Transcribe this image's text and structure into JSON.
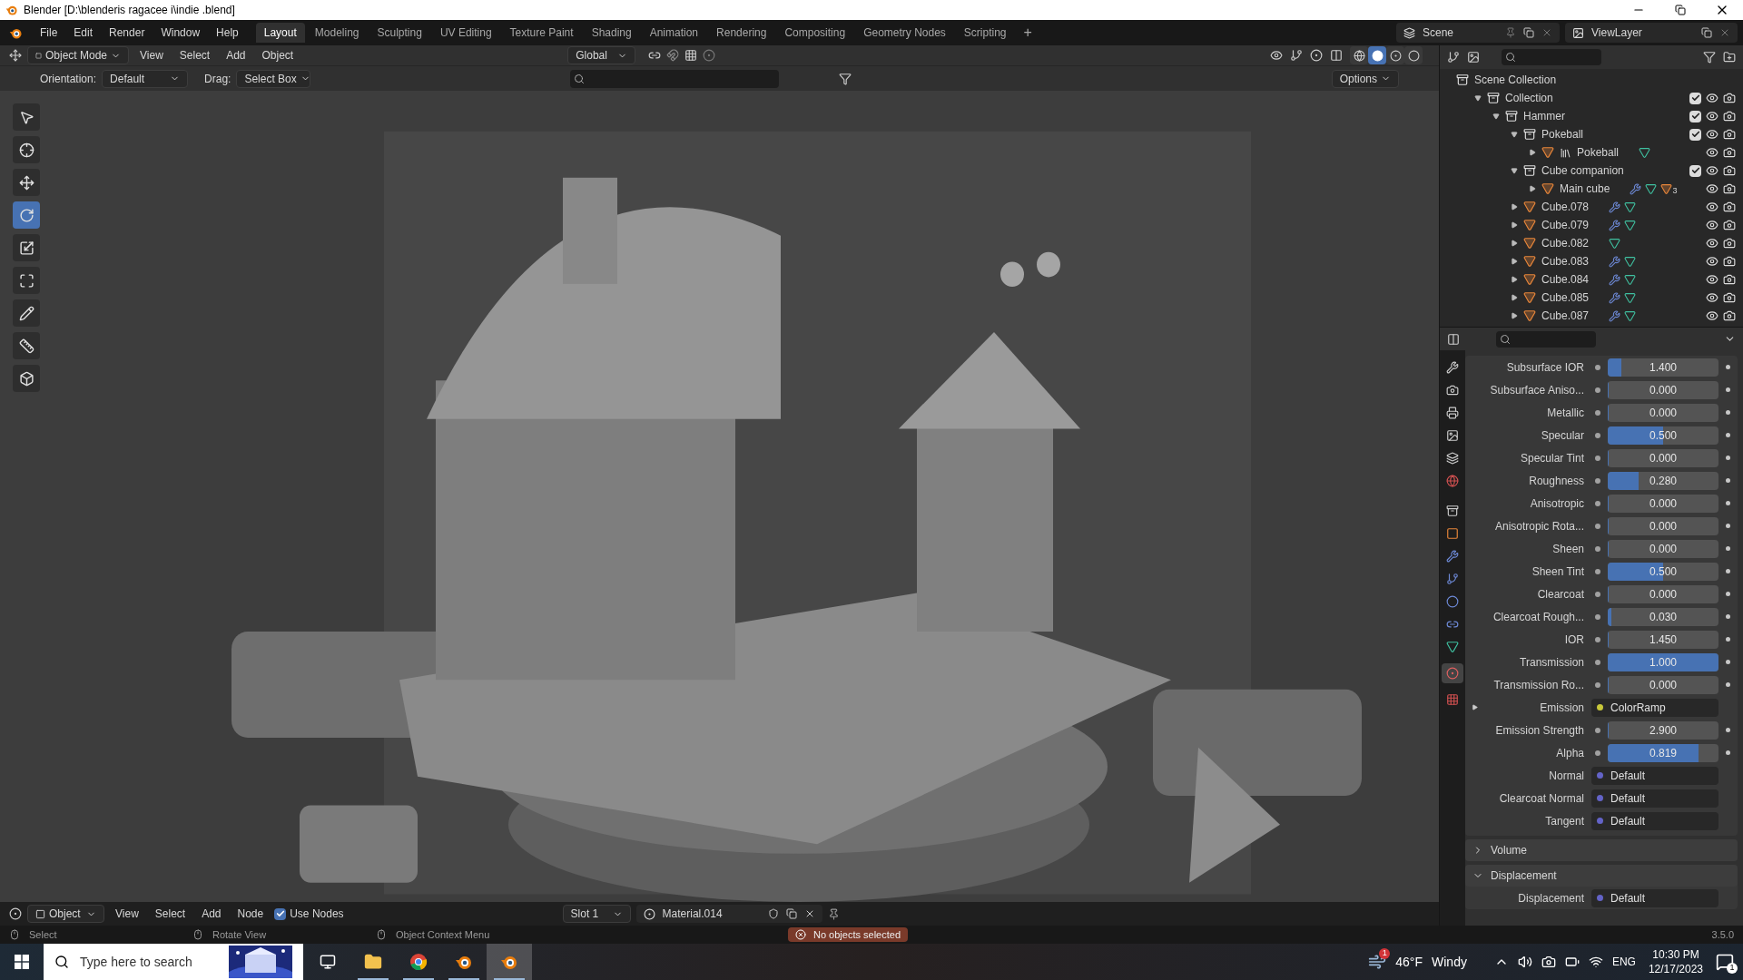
{
  "window": {
    "title": "Blender [D:\\blenderis ragacee i\\indie .blend]"
  },
  "menu": [
    "File",
    "Edit",
    "Render",
    "Window",
    "Help"
  ],
  "workspaces": [
    {
      "label": "Layout",
      "selected": true
    },
    {
      "label": "Modeling",
      "selected": false
    },
    {
      "label": "Sculpting",
      "selected": false
    },
    {
      "label": "UV Editing",
      "selected": false
    },
    {
      "label": "Texture Paint",
      "selected": false
    },
    {
      "label": "Shading",
      "selected": false
    },
    {
      "label": "Animation",
      "selected": false
    },
    {
      "label": "Rendering",
      "selected": false
    },
    {
      "label": "Compositing",
      "selected": false
    },
    {
      "label": "Geometry Nodes",
      "selected": false
    },
    {
      "label": "Scripting",
      "selected": false
    }
  ],
  "add_workspace": "+",
  "scene": "Scene",
  "view_layer": "ViewLayer",
  "viewport": {
    "mode": "Object Mode",
    "menus": [
      "View",
      "Select",
      "Add",
      "Object"
    ],
    "transform": "Global",
    "orientation_label": "Orientation:",
    "orientation": "Default",
    "drag_label": "Drag:",
    "drag": "Select Box",
    "options": "Options",
    "shading": [
      {
        "kind": "wireframe",
        "selected": false
      },
      {
        "kind": "solid",
        "selected": true
      },
      {
        "kind": "material",
        "selected": false
      },
      {
        "kind": "rendered",
        "selected": false
      }
    ],
    "tools": [
      {
        "kind": "select",
        "selected": false
      },
      {
        "kind": "cursor",
        "selected": false
      },
      {
        "kind": "move",
        "selected": false
      },
      {
        "kind": "rotate",
        "selected": true
      },
      {
        "kind": "scale",
        "selected": false
      },
      {
        "kind": "transform",
        "selected": false
      },
      {
        "kind": "annotate",
        "selected": false
      },
      {
        "kind": "measure",
        "selected": false
      },
      {
        "kind": "add-cube",
        "selected": false
      }
    ]
  },
  "outliner": {
    "tree": [
      {
        "label": "Scene Collection",
        "kind": "scene",
        "children": [
          {
            "label": "Collection",
            "kind": "collection",
            "expanded": true,
            "checked": true,
            "children": [
              {
                "label": "Hammer",
                "kind": "collection",
                "expanded": true,
                "checked": true,
                "children": [
                  {
                    "label": "Pokeball",
                    "kind": "collection",
                    "expanded": true,
                    "checked": true,
                    "children": [
                      {
                        "label": "Pokeball",
                        "kind": "object",
                        "expanded": false,
                        "linked": true,
                        "modifier": false,
                        "mesh_data": true
                      }
                    ]
                  },
                  {
                    "label": "Cube companion",
                    "kind": "collection",
                    "expanded": true,
                    "checked": true,
                    "children": [
                      {
                        "label": "Main cube",
                        "kind": "object",
                        "expanded": false,
                        "linked": false,
                        "modifier": true,
                        "mesh_data": true,
                        "child_count": "3"
                      }
                    ]
                  },
                  {
                    "label": "Cube.078",
                    "kind": "object",
                    "expanded": false,
                    "linked": false,
                    "modifier": true,
                    "mesh_data": true
                  },
                  {
                    "label": "Cube.079",
                    "kind": "object",
                    "expanded": false,
                    "linked": false,
                    "modifier": true,
                    "mesh_data": true
                  },
                  {
                    "label": "Cube.082",
                    "kind": "object",
                    "expanded": false,
                    "linked": false,
                    "modifier": false,
                    "mesh_data": true
                  },
                  {
                    "label": "Cube.083",
                    "kind": "object",
                    "expanded": false,
                    "linked": false,
                    "modifier": true,
                    "mesh_data": true
                  },
                  {
                    "label": "Cube.084",
                    "kind": "object",
                    "expanded": false,
                    "linked": false,
                    "modifier": true,
                    "mesh_data": true
                  },
                  {
                    "label": "Cube.085",
                    "kind": "object",
                    "expanded": false,
                    "linked": false,
                    "modifier": true,
                    "mesh_data": true
                  },
                  {
                    "label": "Cube.087",
                    "kind": "object",
                    "expanded": false,
                    "linked": false,
                    "modifier": true,
                    "mesh_data": true
                  }
                ]
              }
            ]
          }
        ]
      }
    ]
  },
  "properties": {
    "rows": [
      {
        "label": "Subsurface IOR",
        "kind": "slider",
        "value": "1.400",
        "level": 0.12
      },
      {
        "label": "Subsurface Aniso...",
        "kind": "slider",
        "value": "0.000",
        "level": 0
      },
      {
        "label": "Metallic",
        "kind": "slider",
        "value": "0.000",
        "level": 0
      },
      {
        "label": "Specular",
        "kind": "slider",
        "value": "0.500",
        "level": 0.5
      },
      {
        "label": "Specular Tint",
        "kind": "slider",
        "value": "0.000",
        "level": 0
      },
      {
        "label": "Roughness",
        "kind": "slider",
        "value": "0.280",
        "level": 0.28
      },
      {
        "label": "Anisotropic",
        "kind": "slider",
        "value": "0.000",
        "level": 0
      },
      {
        "label": "Anisotropic Rota...",
        "kind": "slider",
        "value": "0.000",
        "level": 0
      },
      {
        "label": "Sheen",
        "kind": "slider",
        "value": "0.000",
        "level": 0
      },
      {
        "label": "Sheen Tint",
        "kind": "slider",
        "value": "0.500",
        "level": 0.5
      },
      {
        "label": "Clearcoat",
        "kind": "slider",
        "value": "0.000",
        "level": 0
      },
      {
        "label": "Clearcoat Rough...",
        "kind": "slider",
        "value": "0.030",
        "level": 0.03
      },
      {
        "label": "IOR",
        "kind": "slider",
        "value": "1.450",
        "level": 0
      },
      {
        "label": "Transmission",
        "kind": "slider",
        "value": "1.000",
        "level": 1
      },
      {
        "label": "Transmission Ro...",
        "kind": "slider",
        "value": "0.000",
        "level": 0
      },
      {
        "label": "Emission",
        "kind": "input",
        "value": "ColorRamp",
        "color": "#c8c83a"
      },
      {
        "label": "Emission Strength",
        "kind": "slider",
        "value": "2.900",
        "level": 0
      },
      {
        "label": "Alpha",
        "kind": "slider",
        "value": "0.819",
        "level": 0.819
      },
      {
        "label": "Normal",
        "kind": "link",
        "value": "Default",
        "color": "#6363c7"
      },
      {
        "label": "Clearcoat Normal",
        "kind": "link",
        "value": "Default",
        "color": "#6363c7"
      },
      {
        "label": "Tangent",
        "kind": "link",
        "value": "Default",
        "color": "#6363c7"
      }
    ],
    "panels": [
      {
        "label": "Volume",
        "expanded": false
      },
      {
        "label": "Displacement",
        "expanded": true,
        "rows": [
          {
            "label": "Displacement",
            "kind": "link",
            "value": "Default",
            "color": "#6363c7"
          }
        ]
      }
    ]
  },
  "shader_header": {
    "editor": "Object",
    "menus": [
      "View",
      "Select",
      "Add",
      "Node"
    ],
    "use_nodes": {
      "label": "Use Nodes",
      "checked": true
    },
    "slot": "Slot 1",
    "material": "Material.014"
  },
  "status_bar": {
    "hints": [
      "Select",
      "Rotate View",
      "Object Context Menu"
    ],
    "message": "No objects selected",
    "version": "3.5.0"
  },
  "taskbar": {
    "search_placeholder": "Type here to search",
    "apps": [
      {
        "kind": "task-view",
        "selected": false
      },
      {
        "kind": "explorer",
        "selected": false
      },
      {
        "kind": "chrome",
        "selected": false
      },
      {
        "kind": "blender",
        "selected": false
      },
      {
        "kind": "blender",
        "selected": true
      }
    ],
    "weather_badge": "1",
    "temperature": "46°F",
    "weather": "Windy",
    "language": "ENG",
    "time": "10:30 PM",
    "date": "12/17/2023",
    "notifications": "1"
  }
}
